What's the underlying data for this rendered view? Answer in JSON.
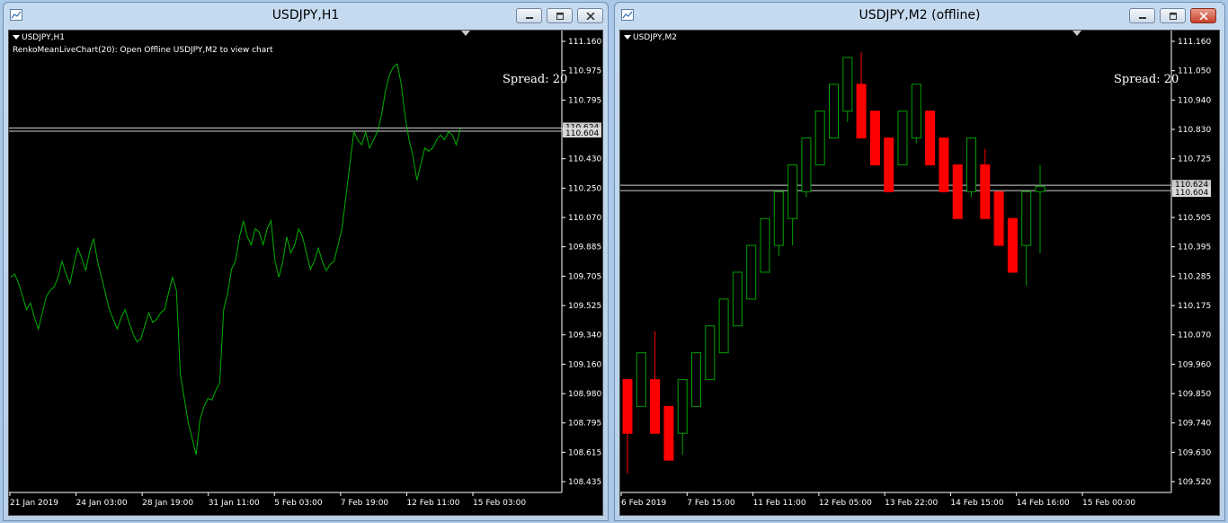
{
  "colors": {
    "bull": "#00a000",
    "bear": "#ff0000",
    "line": "#00b000",
    "axis": "#ffffff",
    "background": "#000000"
  },
  "windows": [
    {
      "title": "USDJPY,H1",
      "symbol_label": "USDJPY,H1",
      "indicator_label": "RenkoMeanLiveChart(20): Open Offline USDJPY,M2 to view chart",
      "spread_label": "Spread:",
      "spread_value": "20",
      "current_price": "110.604",
      "hidden_price": "110.624"
    },
    {
      "title": "USDJPY,M2 (offline)",
      "symbol_label": "USDJPY,M2",
      "spread_label": "Spread:",
      "spread_value": "20",
      "current_price": "110.604",
      "hidden_price": "110.624"
    }
  ],
  "chart_data": [
    {
      "type": "line",
      "title": "USDJPY,H1",
      "y_ticks": [
        "111.160",
        "110.975",
        "110.795",
        "110.610",
        "110.430",
        "110.250",
        "110.070",
        "109.885",
        "109.705",
        "109.525",
        "109.340",
        "109.160",
        "108.980",
        "108.795",
        "108.615",
        "108.435"
      ],
      "x_ticks": [
        "21 Jan 2019",
        "24 Jan 03:00",
        "28 Jan 19:00",
        "31 Jan 11:00",
        "5 Feb 03:00",
        "7 Feb 19:00",
        "12 Feb 11:00",
        "15 Feb 03:00"
      ],
      "ylim": [
        108.435,
        111.16
      ],
      "series": [
        {
          "values": [
            109.7,
            109.72,
            109.66,
            109.58,
            109.5,
            109.54,
            109.45,
            109.38,
            109.48,
            109.58,
            109.62,
            109.64,
            109.7,
            109.8,
            109.72,
            109.66,
            109.78,
            109.88,
            109.82,
            109.74,
            109.86,
            109.94,
            109.8,
            109.7,
            109.6,
            109.5,
            109.44,
            109.38,
            109.45,
            109.5,
            109.42,
            109.35,
            109.3,
            109.32,
            109.4,
            109.48,
            109.42,
            109.44,
            109.48,
            109.5,
            109.6,
            109.7,
            109.62,
            109.1,
            108.95,
            108.8,
            108.7,
            108.6,
            108.82,
            108.9,
            108.95,
            108.94,
            109.0,
            109.05,
            109.5,
            109.6,
            109.75,
            109.8,
            109.95,
            110.05,
            109.95,
            109.9,
            110.0,
            109.98,
            109.9,
            110.0,
            110.05,
            109.8,
            109.7,
            109.8,
            109.95,
            109.85,
            109.9,
            110.0,
            109.95,
            109.85,
            109.75,
            109.8,
            109.88,
            109.8,
            109.74,
            109.78,
            109.8,
            109.9,
            110.0,
            110.2,
            110.4,
            110.6,
            110.55,
            110.52,
            110.6,
            110.5,
            110.55,
            110.6,
            110.7,
            110.85,
            110.95,
            111.0,
            111.02,
            110.9,
            110.7,
            110.55,
            110.45,
            110.3,
            110.4,
            110.5,
            110.48,
            110.5,
            110.55,
            110.58,
            110.55,
            110.6,
            110.58,
            110.52,
            110.62
          ]
        }
      ]
    },
    {
      "type": "candlestick",
      "title": "USDJPY,M2 (offline)",
      "y_ticks": [
        "111.160",
        "111.050",
        "110.940",
        "110.830",
        "110.725",
        "110.615",
        "110.505",
        "110.395",
        "110.285",
        "110.175",
        "110.070",
        "109.960",
        "109.850",
        "109.740",
        "109.630",
        "109.520"
      ],
      "x_ticks": [
        "6 Feb 2019",
        "7 Feb 15:00",
        "11 Feb 11:00",
        "12 Feb 05:00",
        "13 Feb 22:00",
        "14 Feb 15:00",
        "14 Feb 16:00",
        "15 Feb 00:00"
      ],
      "ylim": [
        109.52,
        111.16
      ],
      "candles": [
        {
          "o": 109.9,
          "c": 109.7,
          "h": 109.9,
          "l": 109.55
        },
        {
          "o": 109.8,
          "c": 110.0,
          "h": 110.0,
          "l": 109.8
        },
        {
          "o": 109.9,
          "c": 109.7,
          "h": 110.08,
          "l": 109.7
        },
        {
          "o": 109.8,
          "c": 109.6,
          "h": 109.8,
          "l": 109.6
        },
        {
          "o": 109.7,
          "c": 109.9,
          "h": 109.9,
          "l": 109.62
        },
        {
          "o": 109.8,
          "c": 110.0,
          "h": 110.0,
          "l": 109.8
        },
        {
          "o": 109.9,
          "c": 110.1,
          "h": 110.1,
          "l": 109.9
        },
        {
          "o": 110.0,
          "c": 110.2,
          "h": 110.2,
          "l": 110.0
        },
        {
          "o": 110.1,
          "c": 110.3,
          "h": 110.3,
          "l": 110.1
        },
        {
          "o": 110.2,
          "c": 110.4,
          "h": 110.4,
          "l": 110.2
        },
        {
          "o": 110.3,
          "c": 110.5,
          "h": 110.5,
          "l": 110.3
        },
        {
          "o": 110.4,
          "c": 110.6,
          "h": 110.6,
          "l": 110.36
        },
        {
          "o": 110.5,
          "c": 110.7,
          "h": 110.7,
          "l": 110.4
        },
        {
          "o": 110.6,
          "c": 110.8,
          "h": 110.8,
          "l": 110.58
        },
        {
          "o": 110.7,
          "c": 110.9,
          "h": 110.9,
          "l": 110.7
        },
        {
          "o": 110.8,
          "c": 111.0,
          "h": 111.0,
          "l": 110.8
        },
        {
          "o": 110.9,
          "c": 111.1,
          "h": 111.1,
          "l": 110.86
        },
        {
          "o": 111.0,
          "c": 110.8,
          "h": 111.12,
          "l": 110.8
        },
        {
          "o": 110.9,
          "c": 110.7,
          "h": 110.9,
          "l": 110.7
        },
        {
          "o": 110.8,
          "c": 110.6,
          "h": 110.8,
          "l": 110.6
        },
        {
          "o": 110.7,
          "c": 110.9,
          "h": 110.9,
          "l": 110.7
        },
        {
          "o": 110.8,
          "c": 111.0,
          "h": 111.0,
          "l": 110.78
        },
        {
          "o": 110.9,
          "c": 110.7,
          "h": 110.9,
          "l": 110.7
        },
        {
          "o": 110.8,
          "c": 110.6,
          "h": 110.8,
          "l": 110.6
        },
        {
          "o": 110.7,
          "c": 110.5,
          "h": 110.7,
          "l": 110.5
        },
        {
          "o": 110.6,
          "c": 110.8,
          "h": 110.8,
          "l": 110.58
        },
        {
          "o": 110.7,
          "c": 110.5,
          "h": 110.76,
          "l": 110.5
        },
        {
          "o": 110.6,
          "c": 110.4,
          "h": 110.6,
          "l": 110.4
        },
        {
          "o": 110.5,
          "c": 110.3,
          "h": 110.5,
          "l": 110.3
        },
        {
          "o": 110.4,
          "c": 110.6,
          "h": 110.6,
          "l": 110.25
        },
        {
          "o": 110.6,
          "c": 110.62,
          "h": 110.7,
          "l": 110.37
        }
      ]
    }
  ]
}
